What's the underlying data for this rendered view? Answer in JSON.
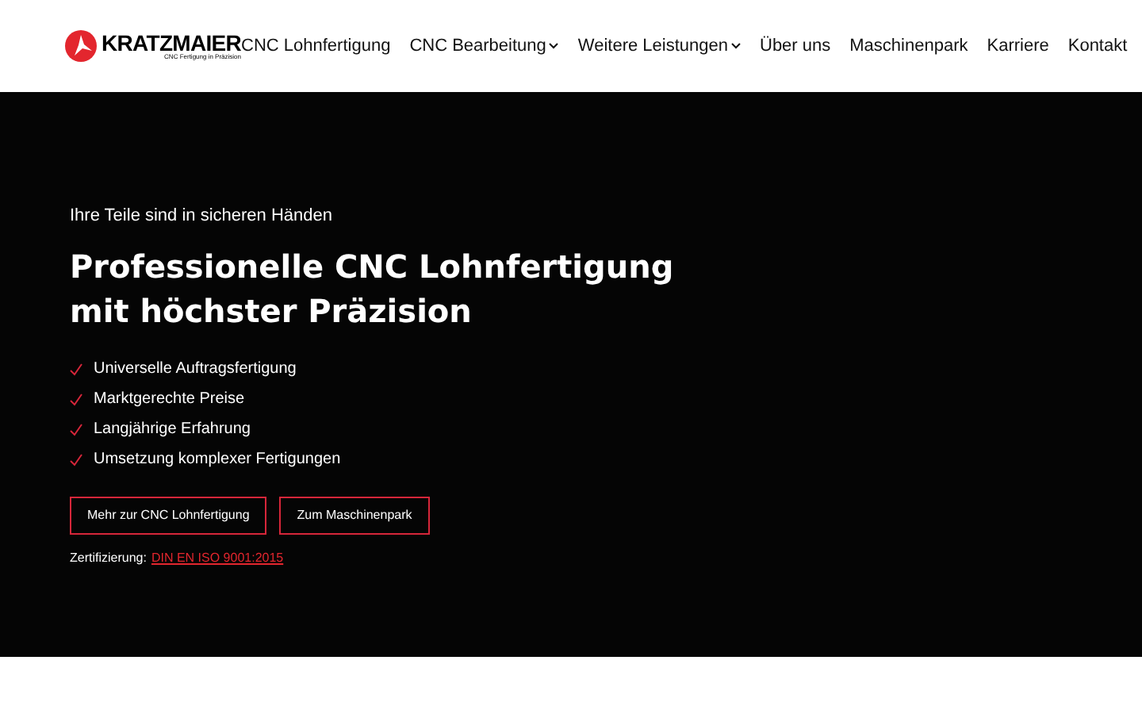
{
  "header": {
    "logo": {
      "name": "KRATZMAIER",
      "tagline": "CNC Fertigung in Präzision"
    },
    "nav": [
      {
        "label": "CNC Lohnfertigung",
        "dropdown": false
      },
      {
        "label": "CNC Bearbeitung",
        "dropdown": true
      },
      {
        "label": "Weitere Leistungen",
        "dropdown": true
      },
      {
        "label": "Über uns",
        "dropdown": false
      },
      {
        "label": "Maschinenpark",
        "dropdown": false
      },
      {
        "label": "Karriere",
        "dropdown": false
      },
      {
        "label": "Kontakt",
        "dropdown": false
      }
    ]
  },
  "hero": {
    "eyebrow": "Ihre Teile sind in sicheren Händen",
    "title_lines": [
      "Professionelle CNC Lohnfertigung",
      "mit höchster Präzision"
    ],
    "features": [
      "Universelle Auftragsfertigung",
      "Marktgerechte Preise",
      "Langjährige Erfahrung",
      "Umsetzung komplexer Fertigungen"
    ],
    "buttons": [
      "Mehr zur CNC Lohnfertigung",
      "Zum Maschinenpark"
    ],
    "certification": {
      "label": "Zertifizierung:",
      "link": "DIN EN ISO 9001:2015"
    }
  }
}
